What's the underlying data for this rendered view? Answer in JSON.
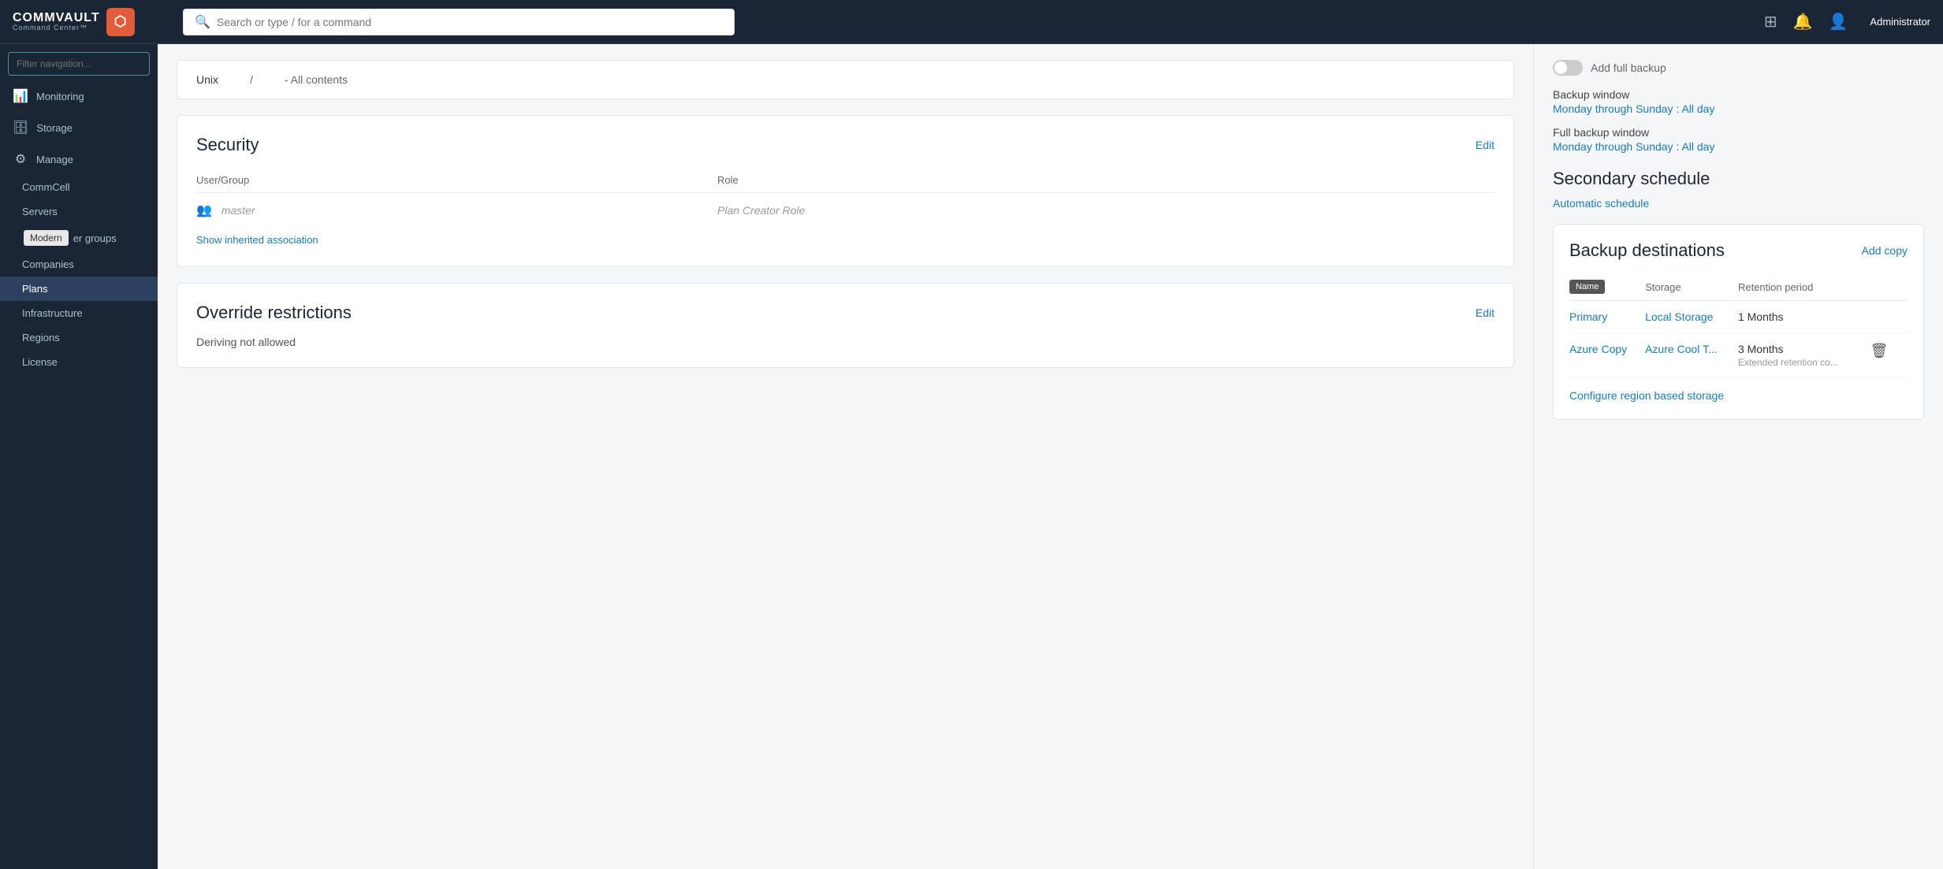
{
  "topbar": {
    "brand": "COMMVAULT",
    "sub": "Command Center™",
    "search_placeholder": "Search or type / for a command",
    "admin_label": "Administrator"
  },
  "sidebar": {
    "filter_placeholder": "Filter navigation...",
    "items": [
      {
        "id": "monitoring",
        "label": "Monitoring",
        "icon": "📊"
      },
      {
        "id": "storage",
        "label": "Storage",
        "icon": "🗄"
      },
      {
        "id": "manage",
        "label": "Manage",
        "icon": "⚙"
      },
      {
        "id": "commcell",
        "label": "CommCell",
        "indent": true
      },
      {
        "id": "servers",
        "label": "Servers",
        "indent": true
      },
      {
        "id": "server-groups",
        "label": "er groups",
        "indent": true,
        "tooltip": "Modern"
      },
      {
        "id": "companies",
        "label": "Companies",
        "indent": true
      },
      {
        "id": "plans",
        "label": "Plans",
        "indent": true,
        "active": true
      },
      {
        "id": "infrastructure",
        "label": "Infrastructure",
        "indent": true
      },
      {
        "id": "regions",
        "label": "Regions",
        "indent": true
      },
      {
        "id": "license",
        "label": "License",
        "indent": true
      }
    ]
  },
  "unix_row": {
    "label": "Unix",
    "separator": "/",
    "path": "- All contents"
  },
  "security": {
    "title": "Security",
    "edit_label": "Edit",
    "col_user_group": "User/Group",
    "col_role": "Role",
    "user": "master",
    "role": "Plan Creator Role",
    "show_inherited": "Show inherited association"
  },
  "override": {
    "title": "Override restrictions",
    "edit_label": "Edit",
    "text": "Deriving not allowed"
  },
  "backup_window": {
    "label": "Backup window",
    "value": "Monday through Sunday : All day"
  },
  "full_backup_window": {
    "label": "Full backup window",
    "value": "Monday through Sunday : All day"
  },
  "secondary_schedule": {
    "title": "Secondary schedule",
    "auto_label": "Automatic schedule"
  },
  "backup_destinations": {
    "title": "Backup destinations",
    "add_copy_label": "Add copy",
    "col_name": "Name",
    "col_storage": "Storage",
    "col_retention": "Retention period",
    "name_tooltip": "Name",
    "rows": [
      {
        "name": "Primary",
        "storage": "Local Storage",
        "retention": "1 Months",
        "retention_sub": "",
        "has_delete": false
      },
      {
        "name": "Azure Copy",
        "storage": "Azure Cool T...",
        "retention": "3 Months",
        "retention_sub": "Extended retention co...",
        "has_delete": true
      }
    ],
    "configure_link": "Configure region based storage"
  }
}
